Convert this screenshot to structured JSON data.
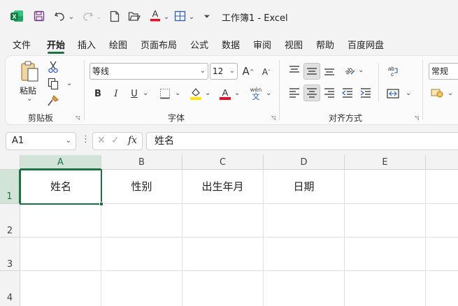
{
  "title": {
    "text": "工作簿1  -  Excel"
  },
  "menu": [
    "文件",
    "开始",
    "插入",
    "绘图",
    "页面布局",
    "公式",
    "数据",
    "审阅",
    "视图",
    "帮助",
    "百度网盘"
  ],
  "clipboard": {
    "paste_label": "粘贴",
    "group_label": "剪贴板"
  },
  "font": {
    "name": "等线",
    "size": "12",
    "group_label": "字体",
    "bold": "B",
    "italic": "I",
    "underline": "U",
    "wen_top": "wén",
    "wen_bottom": "文"
  },
  "alignment": {
    "group_label": "对齐方式"
  },
  "number": {
    "format": "常规"
  },
  "formula_bar": {
    "name_box": "A1",
    "fx": "fx",
    "content": "姓名"
  },
  "columns": [
    "A",
    "B",
    "C",
    "D",
    "E"
  ],
  "rows": [
    "1",
    "2",
    "3",
    "4"
  ],
  "cells": {
    "A1": "姓名",
    "B1": "性别",
    "C1": "出生年月",
    "D1": "日期"
  },
  "colors": {
    "accent": "#1e7145",
    "font_color": "#e81123",
    "highlight": "#ffe600"
  }
}
